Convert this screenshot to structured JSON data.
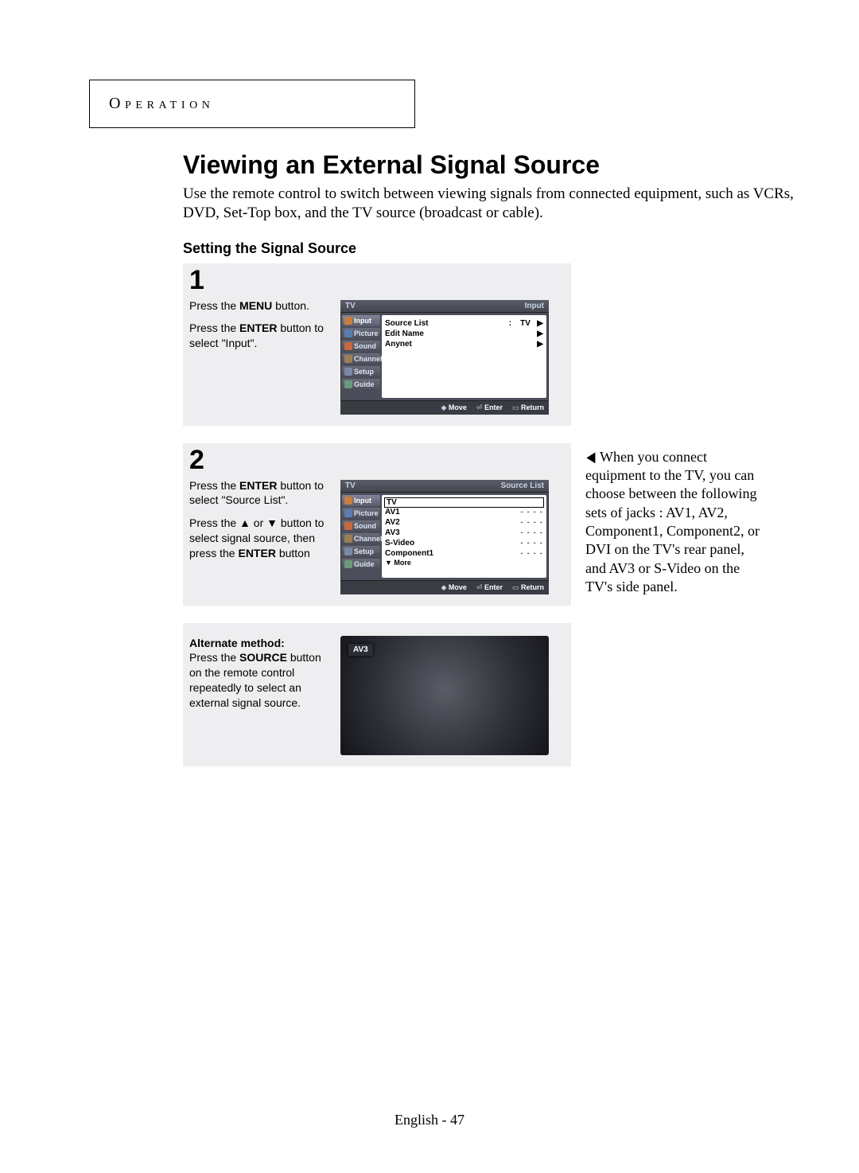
{
  "section_label": "Operation",
  "title": "Viewing an External Signal Source",
  "intro": "Use the remote control to switch between viewing signals from connected equipment, such as VCRs, DVD, Set-Top box, and the TV source (broadcast or cable).",
  "subhead": "Setting the Signal Source",
  "step1": {
    "number": "1",
    "line1a": "Press the ",
    "line1b": "MENU",
    "line1c": " button.",
    "line2a": "Press the ",
    "line2b": "ENTER",
    "line2c": " button to select \"Input\"."
  },
  "osd1": {
    "top_left": "TV",
    "top_right": "Input",
    "tabs": [
      "Input",
      "Picture",
      "Sound",
      "Channel",
      "Setup",
      "Guide"
    ],
    "items": [
      {
        "label": "Source List",
        "sep": ":",
        "value": "TV",
        "arrow": "▶"
      },
      {
        "label": "Edit Name",
        "sep": "",
        "value": "",
        "arrow": "▶"
      },
      {
        "label": "Anynet",
        "sep": "",
        "value": "",
        "arrow": "▶"
      }
    ],
    "foot_move": "Move",
    "foot_enter": "Enter",
    "foot_return": "Return"
  },
  "step2": {
    "number": "2",
    "line1a": "Press the ",
    "line1b": "ENTER",
    "line1c": " button to select \"Source List\".",
    "line2a": "Press the ",
    "line2up": "▲",
    "line2mid": " or ",
    "line2dn": "▼",
    "line2b": " button to select signal source, then press the ",
    "line2c": "ENTER",
    "line2d": " button"
  },
  "osd2": {
    "top_left": "TV",
    "top_right": "Source List",
    "tabs": [
      "Input",
      "Picture",
      "Sound",
      "Channel",
      "Setup",
      "Guide"
    ],
    "list": [
      {
        "label": "TV",
        "dash": "",
        "sel": true
      },
      {
        "label": "AV1",
        "dash": "- - - -"
      },
      {
        "label": "AV2",
        "dash": "- - - -"
      },
      {
        "label": "AV3",
        "dash": "- - - -"
      },
      {
        "label": "S-Video",
        "dash": "- - - -"
      },
      {
        "label": "Component1",
        "dash": "- - - -"
      }
    ],
    "more": "▼ More",
    "foot_move": "Move",
    "foot_enter": "Enter",
    "foot_return": "Return"
  },
  "aside": {
    "tri": "◀",
    "text": "When you connect equipment to the TV, you can choose between the following sets of jacks : AV1, AV2, Component1, Component2, or DVI on the TV's rear panel, and AV3 or S-Video on the TV's side panel."
  },
  "alt": {
    "head": "Alternate method:",
    "a": "Press the ",
    "b": "SOURCE",
    "c": " button on the remote control repeatedly to select an external signal source."
  },
  "tvshot_badge": "AV3",
  "footer": "English - 47"
}
